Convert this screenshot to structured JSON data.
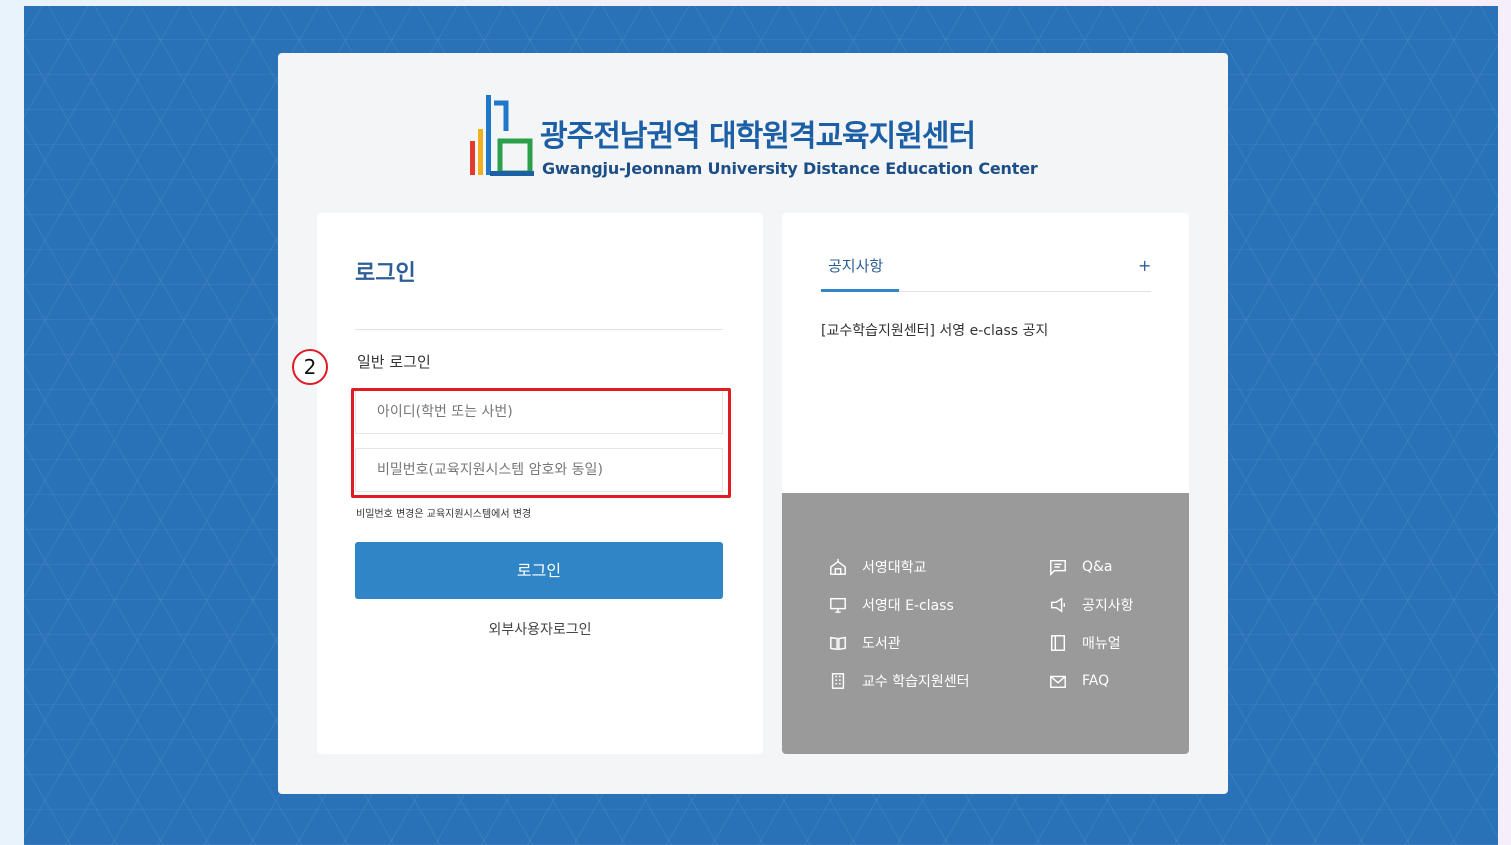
{
  "logo": {
    "title": "광주전남권역 대학원격교육지원센터",
    "subtitle": "Gwangju-Jeonnam University Distance Education Center"
  },
  "login": {
    "title": "로그인",
    "section_label": "일반 로그인",
    "step_badge": "2",
    "id_placeholder": "아이디(학번 또는 사번)",
    "pw_placeholder": "비밀번호(교육지원시스템 암호와 동일)",
    "pw_note": "비밀번호 변경은 교육지원시스템에서 변경",
    "login_button": "로그인",
    "external_login": "외부사용자로그인"
  },
  "notice": {
    "tab_label": "공지사항",
    "more_label": "+",
    "items": [
      "[교수학습지원센터] 서영 e-class 공지"
    ]
  },
  "quick_links": [
    {
      "label": "서영대학교",
      "icon": "school-icon"
    },
    {
      "label": "서영대 E-class",
      "icon": "monitor-icon"
    },
    {
      "label": "도서관",
      "icon": "book-icon"
    },
    {
      "label": "교수 학습지원센터",
      "icon": "building-icon"
    },
    {
      "label": "Q&a",
      "icon": "chat-icon"
    },
    {
      "label": "공지사항",
      "icon": "megaphone-icon"
    },
    {
      "label": "매뉴얼",
      "icon": "manual-icon"
    },
    {
      "label": "FAQ",
      "icon": "mail-icon"
    }
  ],
  "colors": {
    "background": "#2a72b8",
    "primary": "#2f85c5",
    "highlight": "#e01b24",
    "links_bg": "#9a9a9a"
  }
}
